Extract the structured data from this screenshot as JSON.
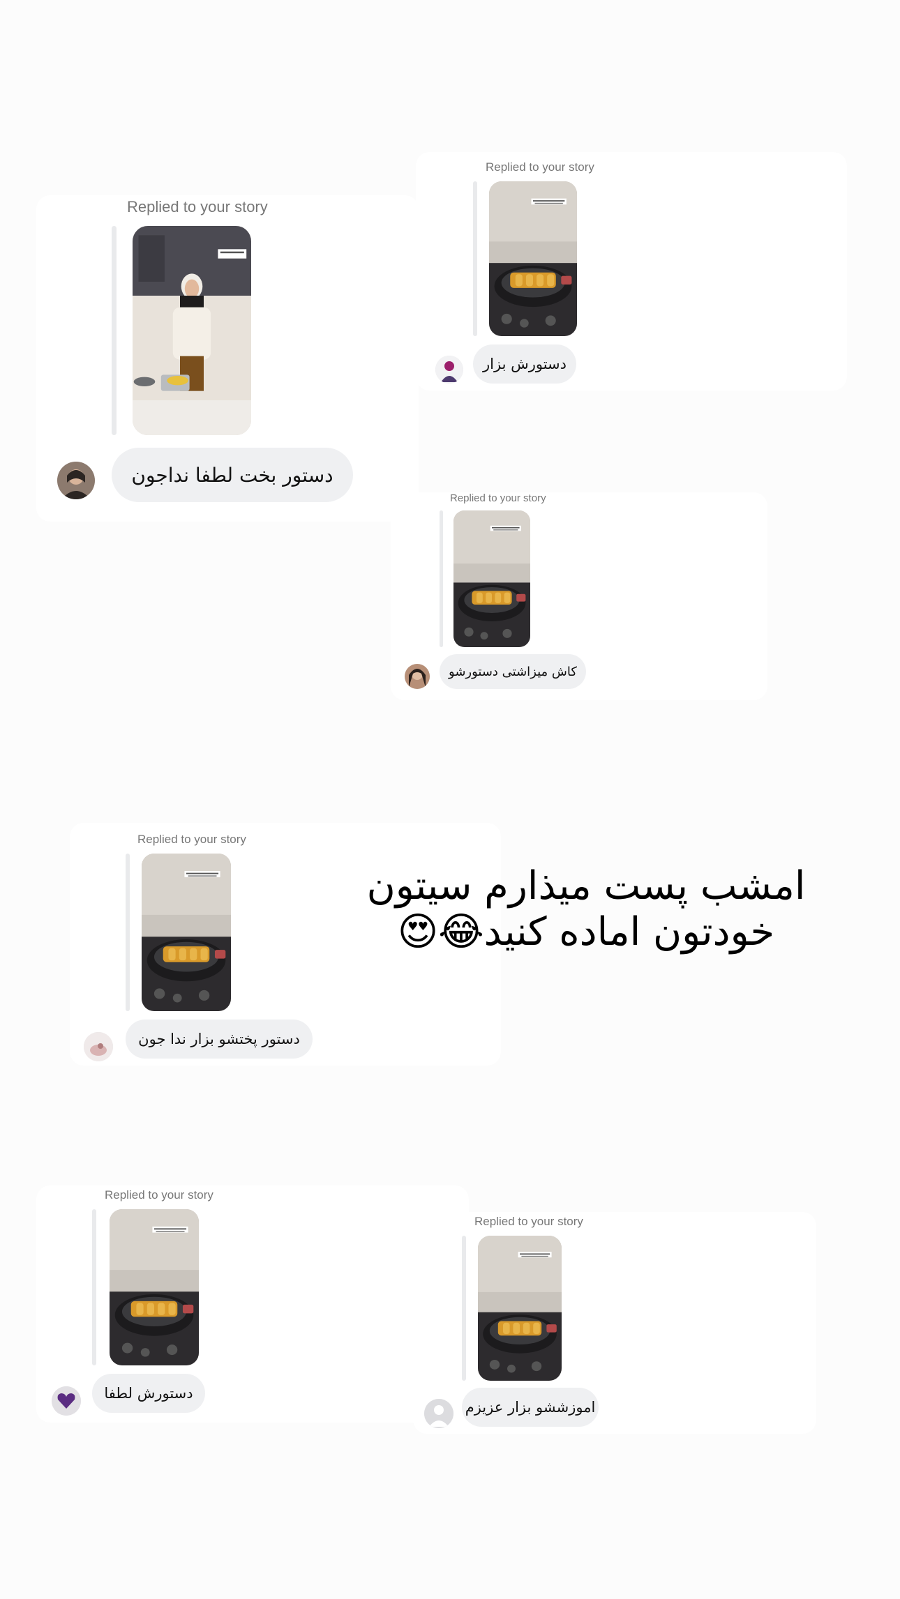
{
  "replies": [
    {
      "replied_label": "Replied to your story",
      "message": "دستور بخت لطفا نداجون",
      "story_thumbnail": "woman-cooking-in-kitchen",
      "avatar": "user-avatar-woman"
    },
    {
      "replied_label": "Replied to your story",
      "message": "دستورش بزار",
      "story_thumbnail": "pan-on-stove",
      "avatar": "user-avatar-illustration"
    },
    {
      "replied_label": "Replied to your story",
      "message": "کاش میزاشتی دستورشو",
      "story_thumbnail": "pan-on-stove",
      "avatar": "user-avatar-woman-2"
    },
    {
      "replied_label": "Replied to your story",
      "message": "دستور پختشو بزار ندا جون",
      "story_thumbnail": "pan-on-stove",
      "avatar": "user-avatar-light"
    },
    {
      "replied_label": "Replied to your story",
      "message": "دستورش لطفا",
      "story_thumbnail": "pan-on-stove",
      "avatar": "user-avatar-purple-heart"
    },
    {
      "replied_label": "Replied to your story",
      "message": "اموزششو بزار عزیزم",
      "story_thumbnail": "pan-on-stove",
      "avatar": "default-avatar"
    }
  ],
  "overlay_text": "امشب پست میذارم سیتون خودتون اماده کنید😂😍",
  "colors": {
    "bubble": "#eff0f2",
    "background": "#fcfcfc",
    "label": "#777777"
  }
}
